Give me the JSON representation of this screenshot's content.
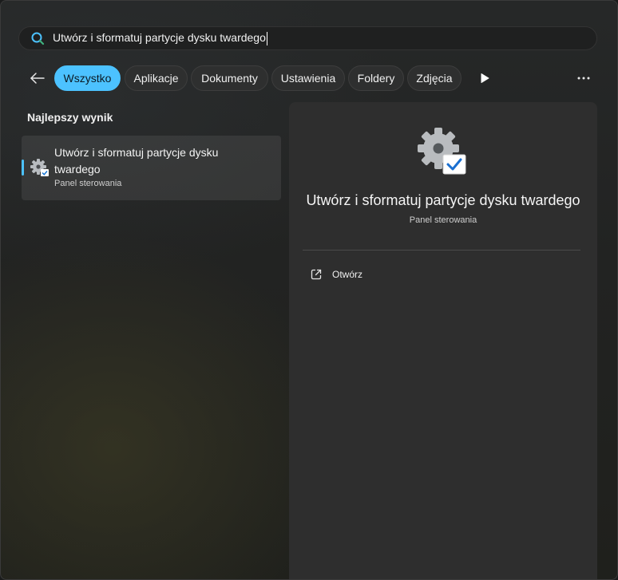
{
  "search": {
    "query": "Utwórz i sformatuj partycje dysku twardego",
    "icon": "search-icon"
  },
  "filters": {
    "back_icon": "back-arrow-icon",
    "tabs": [
      {
        "label": "Wszystko",
        "active": true
      },
      {
        "label": "Aplikacje",
        "active": false
      },
      {
        "label": "Dokumenty",
        "active": false
      },
      {
        "label": "Ustawienia",
        "active": false
      },
      {
        "label": "Foldery",
        "active": false
      },
      {
        "label": "Zdjęcia",
        "active": false
      }
    ],
    "more_icon": "play-icon",
    "overflow_icon": "more-horizontal-icon"
  },
  "results": {
    "section_title": "Najlepszy wynik",
    "best": {
      "title": "Utwórz i sformatuj partycje dysku twardego",
      "subtitle": "Panel sterowania",
      "icon": "gear-check-icon"
    }
  },
  "preview": {
    "title": "Utwórz i sformatuj partycje dysku twardego",
    "subtitle": "Panel sterowania",
    "icon": "gear-check-icon",
    "actions": [
      {
        "label": "Otwórz",
        "icon": "open-external-icon"
      }
    ]
  },
  "colors": {
    "accent": "#4cc2ff",
    "panel_bg": "#222322",
    "preview_bg": "#2e2e2e"
  }
}
